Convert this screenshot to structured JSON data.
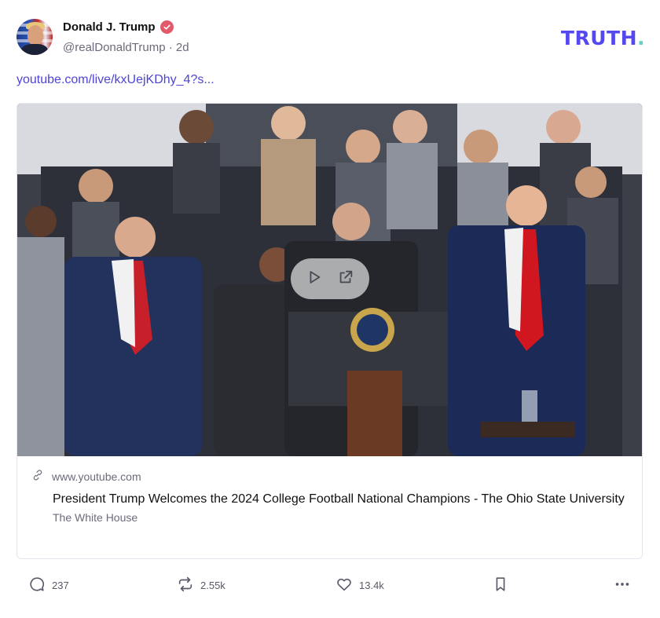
{
  "post": {
    "author": {
      "display_name": "Donald J. Trump",
      "handle": "@realDonaldTrump",
      "time": "· 2d",
      "verified_color": "#e15a6c"
    },
    "brand": {
      "text": "TRUTH",
      "dot": ".",
      "color": "#5448ee",
      "dot_color": "#5ed3c4"
    },
    "link_text": "youtube.com/live/kxUejKDhy_4?s...",
    "card": {
      "domain": "www.youtube.com",
      "title": "President Trump Welcomes the 2024 College Football National Champions - The Ohio State University",
      "source": "The White House"
    },
    "actions": {
      "replies": "237",
      "retruths": "2.55k",
      "likes": "13.4k"
    },
    "icons": [
      "verified-icon",
      "play-icon",
      "open-external-icon",
      "link-icon",
      "reply-icon",
      "retruth-icon",
      "like-icon",
      "bookmark-icon",
      "more-icon"
    ]
  }
}
